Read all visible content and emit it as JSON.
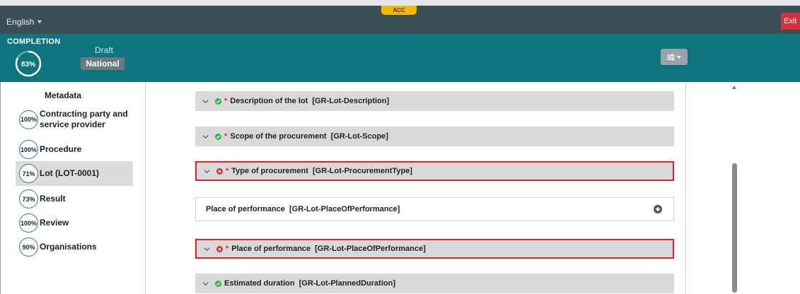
{
  "topbar": {
    "language": "English",
    "environment_badge": "ACC",
    "exit_label": "Exit",
    "colors": {
      "background": "#3a4e56",
      "badge": "#f5b800",
      "exit": "#d6303f"
    }
  },
  "completion": {
    "label": "COMPLETION",
    "percent": "83%",
    "percent_value": 0.83,
    "status": "Draft",
    "scope_badge": "National",
    "colors": {
      "background": "#10747e"
    }
  },
  "sidebar": {
    "items": [
      {
        "label": "Metadata",
        "percent": ""
      },
      {
        "label": "Contracting party and service provider",
        "percent": "100%"
      },
      {
        "label": "Procedure",
        "percent": "100%"
      },
      {
        "label": "Lot (LOT-0001)",
        "percent": "71%",
        "selected": true
      },
      {
        "label": "Result",
        "percent": "73%"
      },
      {
        "label": "Review",
        "percent": "100%"
      },
      {
        "label": "Organisations",
        "percent": "90%"
      }
    ]
  },
  "main": {
    "panels": [
      {
        "label": "Description of the lot  [GR-Lot-Description]",
        "required": "*",
        "status": "ok"
      },
      {
        "label": "Scope of the procurement  [GR-Lot-Scope]",
        "required": "*",
        "status": "ok"
      },
      {
        "label": "Type of procurement  [GR-Lot-ProcurementType]",
        "required": "*",
        "status": "error"
      },
      {
        "label": "Place of performance  [GR-Lot-PlaceOfPerformance]",
        "required": "",
        "status": "none"
      },
      {
        "label": "Place of performance  [GR-Lot-PlaceOfPerformance]",
        "required": "*",
        "status": "error"
      },
      {
        "label": "Estimated duration  [GR-Lot-PlannedDuration]",
        "required": "",
        "status": "ok"
      }
    ]
  }
}
